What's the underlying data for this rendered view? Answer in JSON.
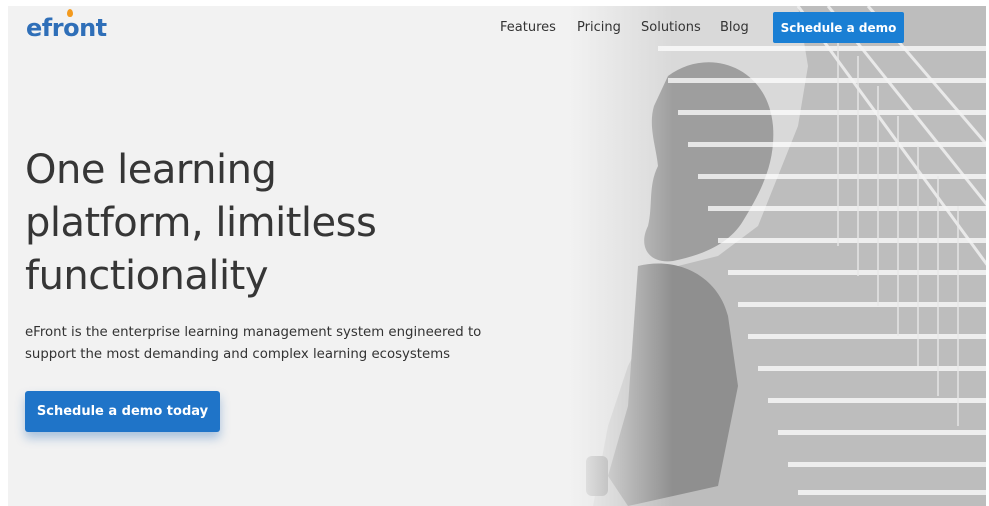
{
  "header": {
    "logo_text_before": "efr",
    "logo_text_o": "o",
    "logo_text_after": "nt",
    "nav_items": [
      {
        "label": "Features"
      },
      {
        "label": "Pricing"
      },
      {
        "label": "Solutions"
      },
      {
        "label": "Blog"
      }
    ],
    "cta_label": "Schedule a demo"
  },
  "hero": {
    "headline_lines": [
      "One learning",
      "platform, limitless",
      "functionality"
    ],
    "subtext_lines": [
      "eFront is the enterprise learning management system engineered to",
      "support the most demanding and complex learning ecosystems"
    ],
    "cta_label": "Schedule a demo today",
    "image_icon": "person-staircase-duotone"
  },
  "colors": {
    "brand_blue": "#2f6fb8",
    "button_blue": "#1a7fd4",
    "logo_accent": "#f39a1e",
    "background": "#f2f2f2"
  }
}
